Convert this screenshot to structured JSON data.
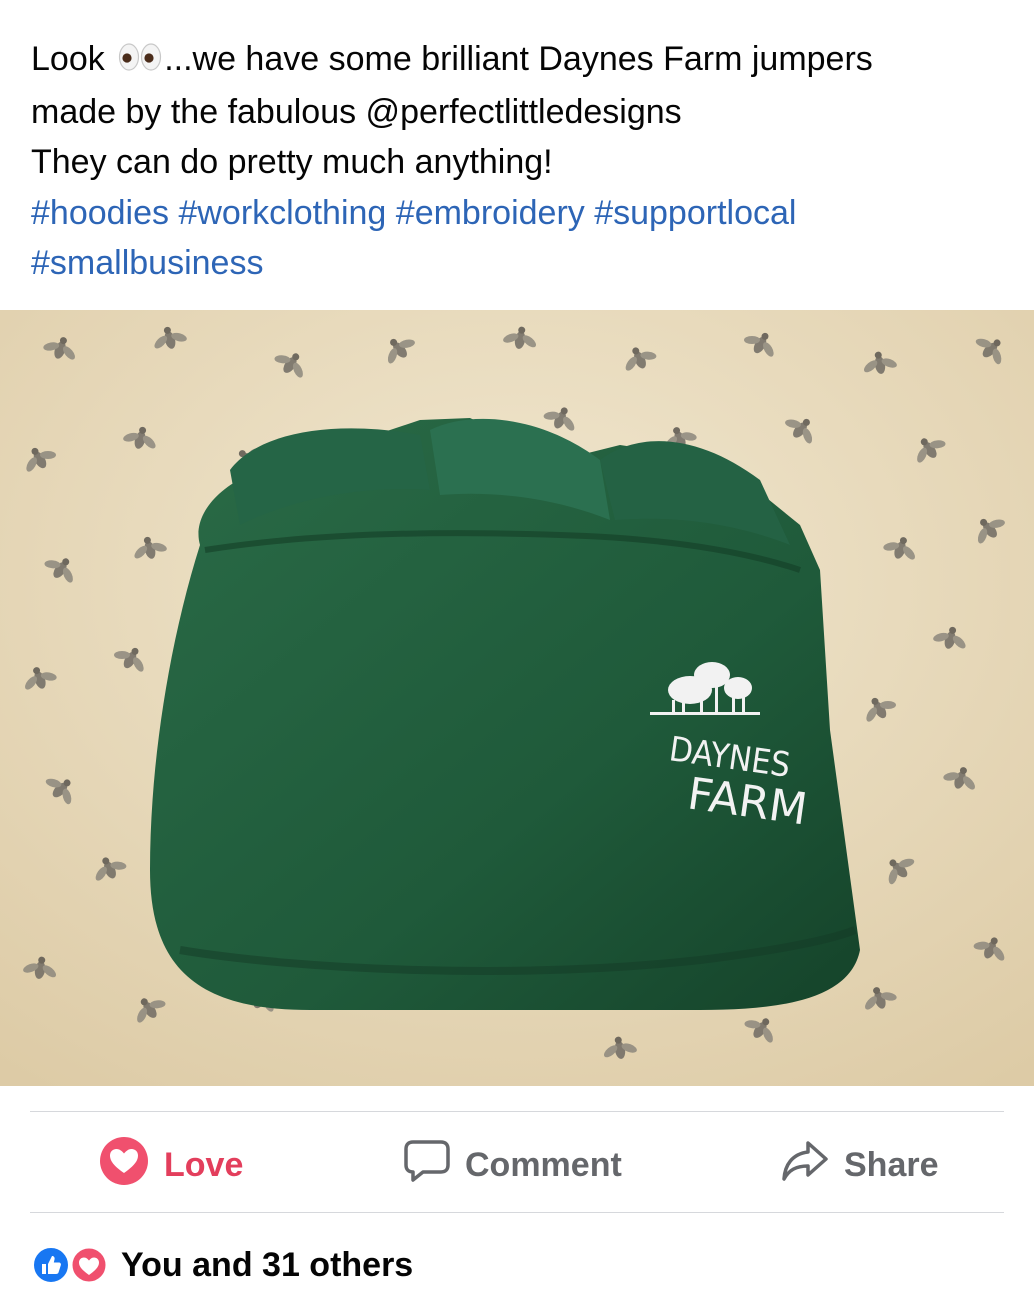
{
  "post": {
    "text_line1_before": "Look",
    "text_line1_after": "...we have some brilliant Daynes Farm jumpers",
    "text_line2": "made by the fabulous @perfectlittledesigns",
    "text_line3": "They can do pretty much anything!",
    "hashtags_line1": "#hoodies #workclothing #embroidery #supportlocal",
    "hashtags_line2": "#smallbusiness",
    "emoji": "eyes-emoji"
  },
  "photo": {
    "embroidery_line1": "DAYNES",
    "embroidery_line2": "FARM",
    "jumper_color": "#1f5a3a",
    "background_color": "#e9dcc0"
  },
  "actions": {
    "love_label": "Love",
    "comment_label": "Comment",
    "share_label": "Share"
  },
  "reactions": {
    "summary": "You and 31 others",
    "icons": [
      "like-reaction-icon",
      "love-reaction-icon"
    ]
  },
  "colors": {
    "hashtag": "#2d65b6",
    "love": "#e33e5c",
    "action_gray": "#65676b",
    "like_blue": "#1877f2"
  }
}
